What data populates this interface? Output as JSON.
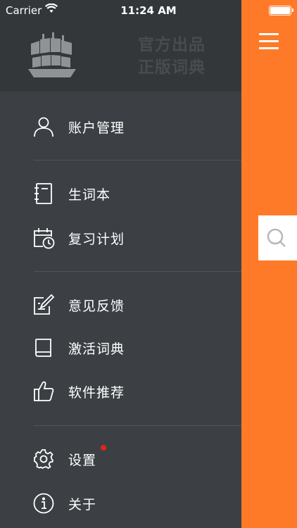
{
  "status_bar": {
    "carrier": "Carrier",
    "time": "11:24 AM"
  },
  "header": {
    "slogan_line1": "官方出品",
    "slogan_line2": "正版词典",
    "logo": "ship-logo-icon"
  },
  "menu": {
    "account": {
      "label": "账户管理",
      "icon": "user-icon"
    },
    "wordbook": {
      "label": "生词本",
      "icon": "notebook-icon"
    },
    "review": {
      "label": "复习计划",
      "icon": "calendar-clock-icon"
    },
    "feedback": {
      "label": "意见反馈",
      "icon": "edit-icon"
    },
    "activate": {
      "label": "激活词典",
      "icon": "book-icon"
    },
    "recommend": {
      "label": "软件推荐",
      "icon": "thumbs-up-icon"
    },
    "settings": {
      "label": "设置",
      "icon": "gear-icon"
    },
    "about": {
      "label": "关于",
      "icon": "info-icon"
    }
  },
  "colors": {
    "accent": "#fe7a28",
    "drawer_bg": "#3c4044",
    "header_bg": "#33373a",
    "badge": "#e2231a"
  }
}
